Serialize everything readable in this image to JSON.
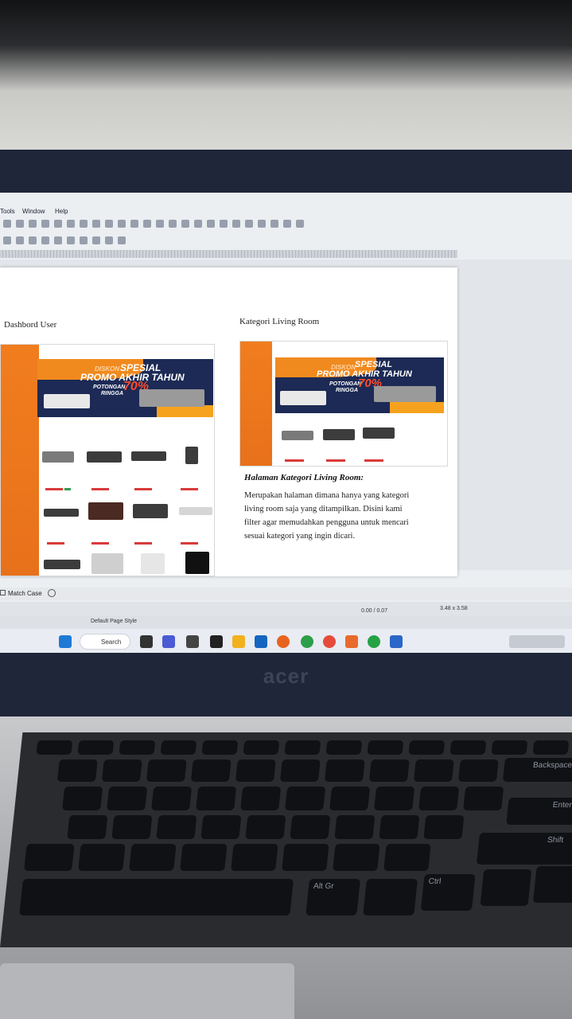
{
  "menu": {
    "tools": "Tools",
    "window": "Window",
    "help": "Help"
  },
  "document": {
    "left_caption": "Dashbord User",
    "right_caption": "Kategori Living Room",
    "banner": {
      "diskon": "DISKON",
      "spesial": "SPESIAL",
      "promo": "PROMO AKHIR TAHUN",
      "potongan": "POTONGAN",
      "ringga": "RINGGA",
      "percent": "70%"
    },
    "heading": "Halaman Kategori Living Room:",
    "paragraph": [
      "Merupakan halaman dimana hanya yang kategori",
      "living room saja yang ditampilkan. Disini kami",
      "filter agar memudahkan pengguna untuk mencari",
      "sesuai kategori yang ingin dicari."
    ]
  },
  "findbar": {
    "match_case": "Match Case"
  },
  "status": {
    "page_style": "Default Page Style",
    "position": "0.00 / 0.07",
    "size": "3.48 x 3.58"
  },
  "taskbar": {
    "search": "Search"
  },
  "laptop": {
    "brand": "acer"
  },
  "keyboard": {
    "backspace": "Backspace",
    "enter": "Enter",
    "shift": "Shift",
    "altgr": "Alt Gr",
    "ctrl": "Ctrl"
  }
}
